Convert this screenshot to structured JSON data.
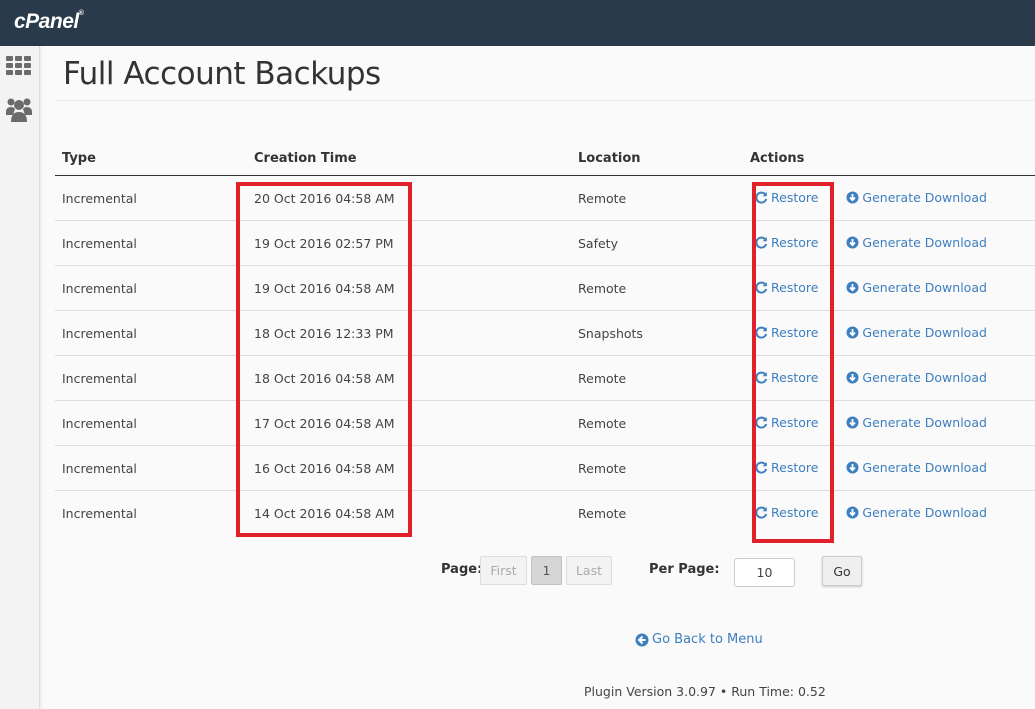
{
  "app": {
    "brand": "cPanel"
  },
  "sidebar": {
    "items": [
      {
        "icon": "grid-icon"
      },
      {
        "icon": "users-icon"
      }
    ]
  },
  "page": {
    "title": "Full Account Backups"
  },
  "table": {
    "headers": {
      "type": "Type",
      "time": "Creation Time",
      "location": "Location",
      "actions": "Actions"
    },
    "rows": [
      {
        "type": "Incremental",
        "time": "20 Oct 2016 04:58 AM",
        "location": "Remote",
        "restore": "Restore",
        "download": "Generate Download"
      },
      {
        "type": "Incremental",
        "time": "19 Oct 2016 02:57 PM",
        "location": "Safety",
        "restore": "Restore",
        "download": "Generate Download"
      },
      {
        "type": "Incremental",
        "time": "19 Oct 2016 04:58 AM",
        "location": "Remote",
        "restore": "Restore",
        "download": "Generate Download"
      },
      {
        "type": "Incremental",
        "time": "18 Oct 2016 12:33 PM",
        "location": "Snapshots",
        "restore": "Restore",
        "download": "Generate Download"
      },
      {
        "type": "Incremental",
        "time": "18 Oct 2016 04:58 AM",
        "location": "Remote",
        "restore": "Restore",
        "download": "Generate Download"
      },
      {
        "type": "Incremental",
        "time": "17 Oct 2016 04:58 AM",
        "location": "Remote",
        "restore": "Restore",
        "download": "Generate Download"
      },
      {
        "type": "Incremental",
        "time": "16 Oct 2016 04:58 AM",
        "location": "Remote",
        "restore": "Restore",
        "download": "Generate Download"
      },
      {
        "type": "Incremental",
        "time": "14 Oct 2016 04:58 AM",
        "location": "Remote",
        "restore": "Restore",
        "download": "Generate Download"
      }
    ]
  },
  "pagination": {
    "page_label": "Page:",
    "first": "First",
    "current": "1",
    "last": "Last",
    "per_page_label": "Per Page:",
    "per_page_value": "10",
    "go": "Go"
  },
  "nav": {
    "back": "Go Back to Menu"
  },
  "footer": {
    "text": "Plugin Version 3.0.97 • Run Time: 0.52"
  },
  "colors": {
    "topbar": "#293a4a",
    "link": "#3d7fbf",
    "highlight": "#e0202a"
  }
}
